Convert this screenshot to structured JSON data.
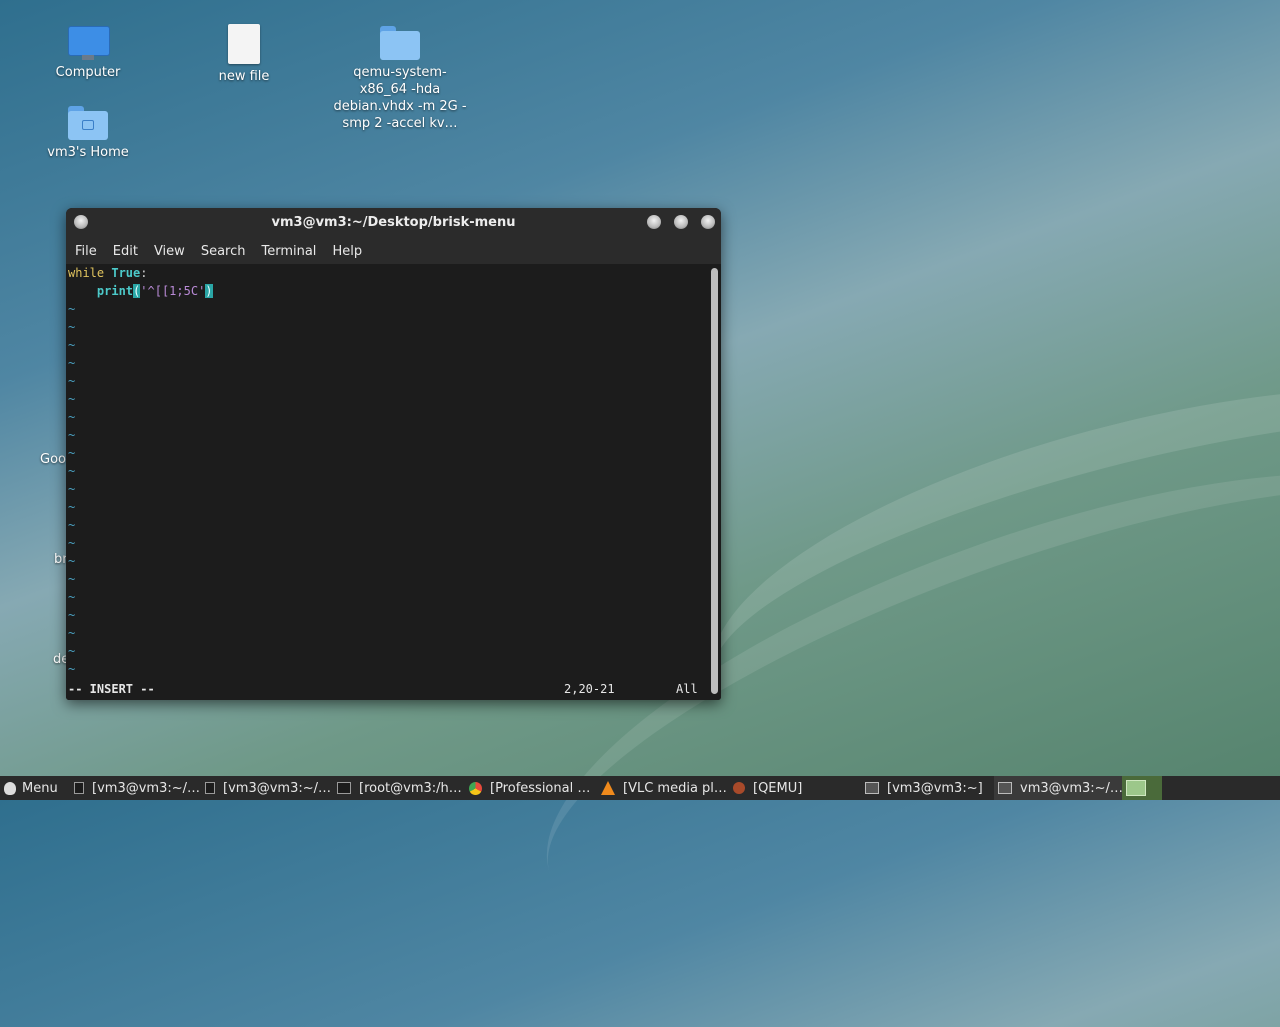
{
  "desktop": {
    "icons": [
      {
        "label": "Computer",
        "icon": "computer-icon"
      },
      {
        "label": "new file",
        "icon": "file-icon"
      },
      {
        "label": "qemu-system-x86_64 -hda debian.vhdx -m 2G -smp 2 -accel kv…",
        "icon": "folder-icon"
      },
      {
        "label": "vm3's Home",
        "icon": "home-folder-icon"
      }
    ],
    "partial_labels": [
      "Goo",
      "br",
      "de"
    ]
  },
  "terminal": {
    "title": "vm3@vm3:~/Desktop/brisk-menu",
    "menu": [
      "File",
      "Edit",
      "View",
      "Search",
      "Terminal",
      "Help"
    ],
    "code": {
      "line1_kw": "while",
      "line1_const": "True",
      "line1_colon": ":",
      "line2_indent": "    ",
      "line2_fn": "print",
      "line2_open": "(",
      "line2_str": "'^[[1;5C'",
      "line2_close": ")"
    },
    "tilde": "~",
    "status_mode": "-- INSERT --",
    "status_pos": "2,20-21",
    "status_scroll": "All"
  },
  "taskbar": {
    "menu_label": "Menu",
    "items": [
      {
        "label": "[vm3@vm3:~/…",
        "icon": "terminal-icon"
      },
      {
        "label": "[vm3@vm3:~/…",
        "icon": "terminal-icon"
      },
      {
        "label": "[root@vm3:/h…",
        "icon": "terminal-icon"
      },
      {
        "label": "[Professional …",
        "icon": "chrome-icon"
      },
      {
        "label": "[VLC media pl…",
        "icon": "vlc-icon"
      },
      {
        "label": "[QEMU]",
        "icon": "qemu-icon"
      },
      {
        "label": "[vm3@vm3:~]",
        "icon": "window-icon"
      },
      {
        "label": "vm3@vm3:~/…",
        "icon": "window-icon"
      }
    ]
  }
}
